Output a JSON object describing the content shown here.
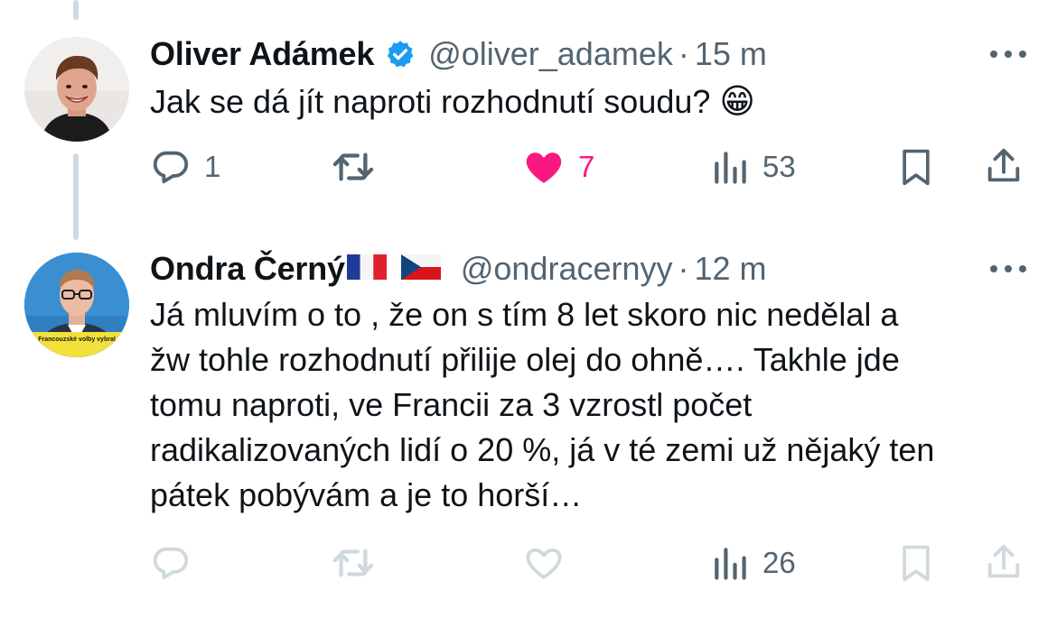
{
  "tweets": [
    {
      "author_name": "Oliver Adámek",
      "verified": true,
      "handle": "@oliver_adamek",
      "separator": "·",
      "time": "15 m",
      "text": "Jak se dá jít naproti rozhodnutí soudu?",
      "emoji": "😁",
      "actions": {
        "reply_count": "1",
        "retweet_count": "",
        "like_count": "7",
        "liked": true,
        "views_count": "53"
      }
    },
    {
      "author_name": "Ondra Černý",
      "flags": [
        "🇫🇷",
        "🇨🇿"
      ],
      "handle": "@ondracernyy",
      "separator": "·",
      "time": "12 m",
      "text_lines": [
        "Já mluvím o to , že on s tím 8 let skoro nic nedělal a",
        "žw tohle rozhodnutí přilije olej do ohně…. Takhle jde",
        "tomu naproti, ve Francii za 3 vzrostl počet",
        "radikalizovaných lidí o 20 %, já v té zemi už nějaký ten",
        "pátek pobývám a je to horší…"
      ],
      "avatar_caption": "Francouzské volby vybral",
      "actions": {
        "reply_count": "",
        "retweet_count": "",
        "like_count": "",
        "liked": false,
        "views_count": "26"
      }
    }
  ],
  "colors": {
    "text": "#0f1419",
    "secondary": "#536471",
    "like": "#f91880",
    "verified": "#1d9bf0",
    "thread_line": "#cfd9de",
    "faded_icon": "#cfd9de"
  }
}
